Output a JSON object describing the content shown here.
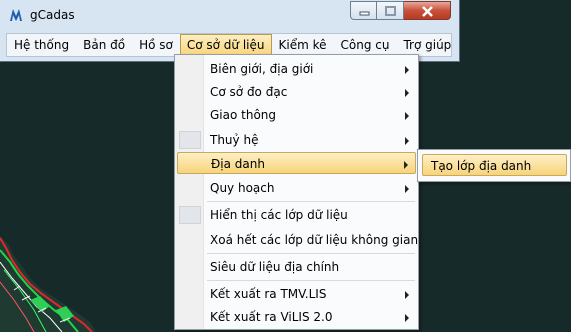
{
  "window": {
    "title": "gCadas",
    "icon": "gcadas-logo-icon"
  },
  "menubar": {
    "items": [
      {
        "label": "Hệ thống"
      },
      {
        "label": "Bản đồ"
      },
      {
        "label": "Hồ sơ"
      },
      {
        "label": "Cơ sở dữ liệu",
        "active": true
      },
      {
        "label": "Kiểm kê"
      },
      {
        "label": "Công cụ"
      },
      {
        "label": "Trợ giúp"
      }
    ]
  },
  "dropdown": {
    "items": [
      {
        "label": "Biên giới, địa giới",
        "submenu": true
      },
      {
        "label": "Cơ sở đo đạc",
        "submenu": true
      },
      {
        "label": "Giao thông",
        "submenu": true
      },
      {
        "label": "Thuỷ hệ",
        "submenu": true
      },
      {
        "label": "Địa danh",
        "submenu": true,
        "highlighted": true
      },
      {
        "label": "Quy hoạch",
        "submenu": true
      },
      {
        "label": "Hiển thị các lớp dữ liệu"
      },
      {
        "label": "Xoá hết các lớp dữ liệu không gian"
      },
      {
        "label": "Siêu dữ liệu địa chính"
      },
      {
        "label": "Kết xuất ra TMV.LIS",
        "submenu": true
      },
      {
        "label": "Kết xuất ra ViLIS 2.0",
        "submenu": true
      }
    ]
  },
  "submenu": {
    "items": [
      {
        "label": "Tạo lớp địa danh",
        "highlighted": true
      }
    ]
  },
  "colors": {
    "map_background": "#172a2a",
    "highlight": "#f8d47a",
    "window_frame": "#d7e4f2"
  }
}
